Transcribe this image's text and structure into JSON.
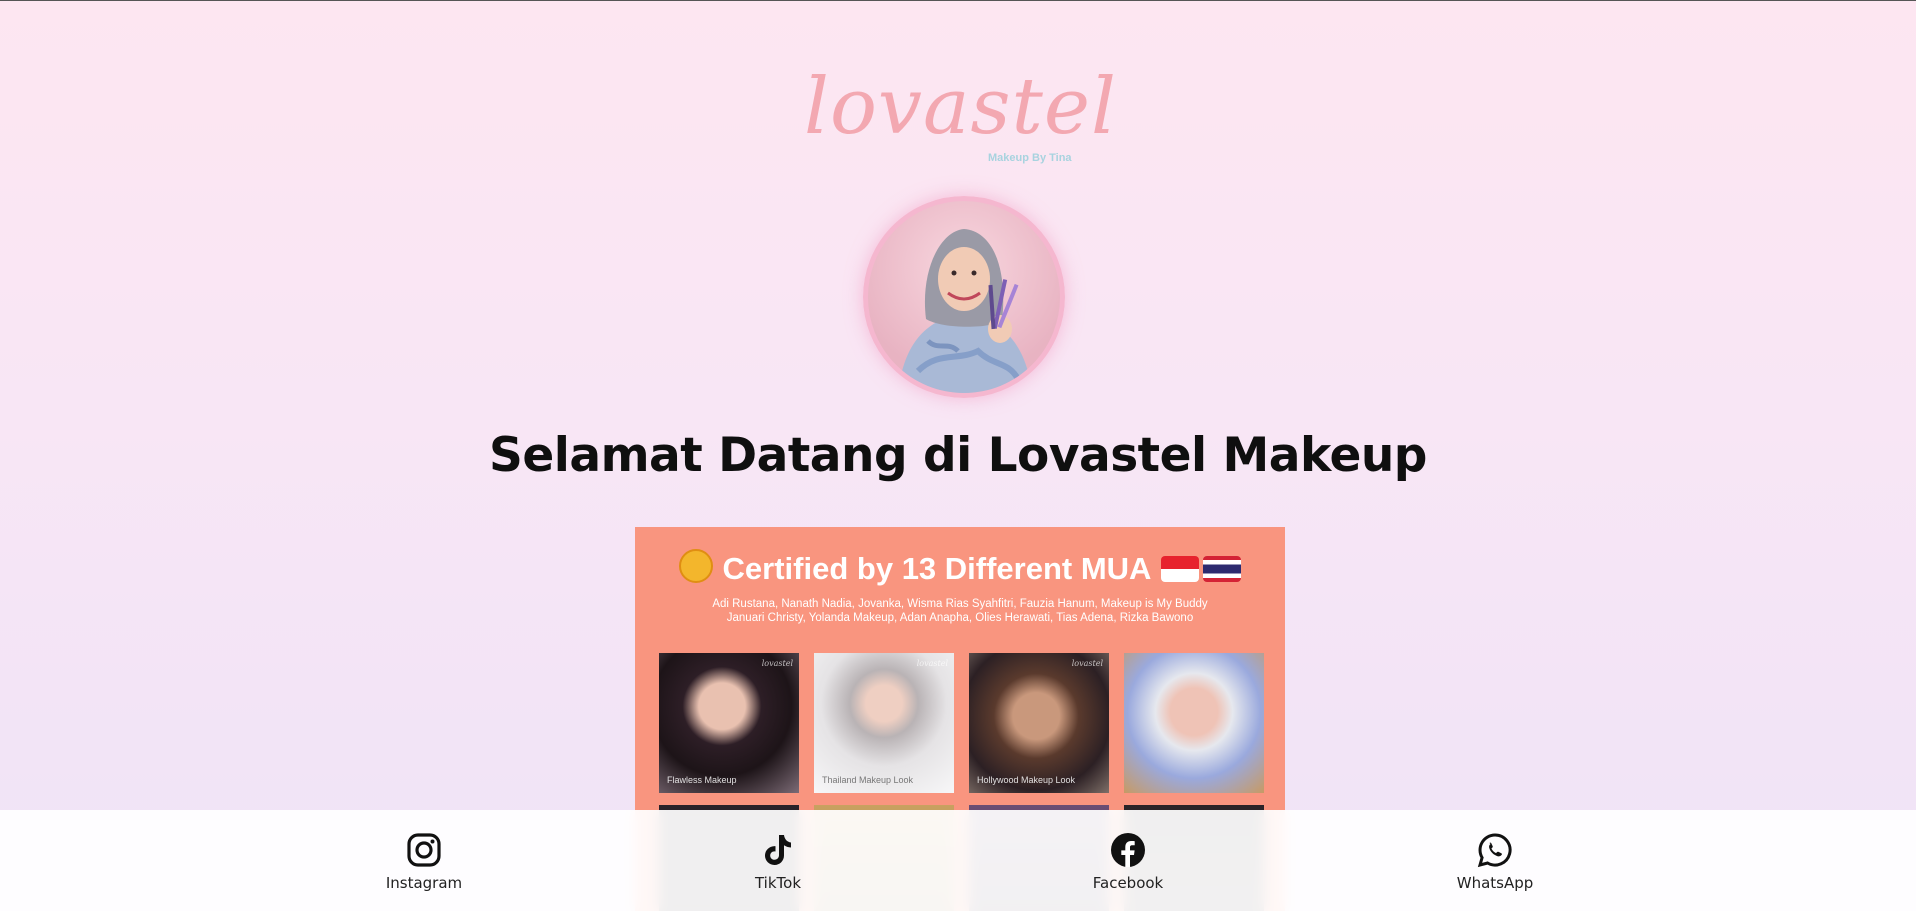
{
  "brand": {
    "logo_text": "lovastel",
    "logo_subtitle": "Makeup By Tina",
    "logo_color": "#f3a8b1",
    "subtitle_color": "#a8d3df"
  },
  "main": {
    "title": "Selamat Datang di Lovastel Makeup"
  },
  "banner": {
    "background": "#f9957f",
    "title": "Certified by 13 Different MUA",
    "names_line1": "Adi Rustana, Nanath Nadia, Jovanka, Wisma Rias Syahfitri, Fauzia Hanum, Makeup is My Buddy",
    "names_line2": "Januari Christy, Yolanda Makeup, Adan Anapha, Olies Herawati, Tias Adena, Rizka Bawono",
    "tiles": [
      {
        "caption": "Flawless Makeup",
        "mark": "lovastel"
      },
      {
        "caption": "Thailand Makeup Look",
        "mark": "lovastel"
      },
      {
        "caption": "Hollywood Makeup Look",
        "mark": "lovastel"
      },
      {
        "caption": "",
        "mark": ""
      }
    ]
  },
  "bottom_nav": {
    "items": [
      {
        "label": "Instagram",
        "icon": "instagram-icon"
      },
      {
        "label": "TikTok",
        "icon": "tiktok-icon"
      },
      {
        "label": "Facebook",
        "icon": "facebook-icon"
      },
      {
        "label": "WhatsApp",
        "icon": "whatsapp-icon"
      }
    ]
  }
}
